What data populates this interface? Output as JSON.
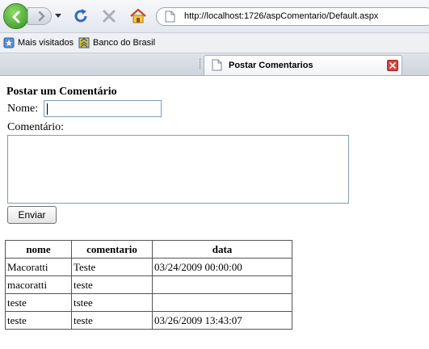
{
  "browser": {
    "url": "http://localhost:1726/aspComentario/Default.aspx",
    "bookmarks": [
      {
        "label": "Mais visitados",
        "icon": "bookmark-star-icon"
      },
      {
        "label": "Banco do Brasil",
        "icon": "banco-brasil-icon"
      }
    ],
    "tab": {
      "title": "Postar Comentarios"
    }
  },
  "page": {
    "heading": "Postar um Comentário",
    "name_label": "Nome:",
    "name_value": "",
    "comment_label": "Comentário:",
    "comment_value": "",
    "send_label": "Enviar"
  },
  "table": {
    "headers": [
      "nome",
      "comentario",
      "data"
    ],
    "rows": [
      [
        "Macoratti",
        "Teste",
        "03/24/2009 00:00:00"
      ],
      [
        "macoratti",
        "teste",
        ""
      ],
      [
        "teste",
        "tstee",
        ""
      ],
      [
        "teste",
        "teste",
        "03/26/2009 13:43:07"
      ]
    ]
  },
  "colors": {
    "back_button": "#3a9a26",
    "close_tab": "#d9413b",
    "input_border": "#7f9db9"
  }
}
